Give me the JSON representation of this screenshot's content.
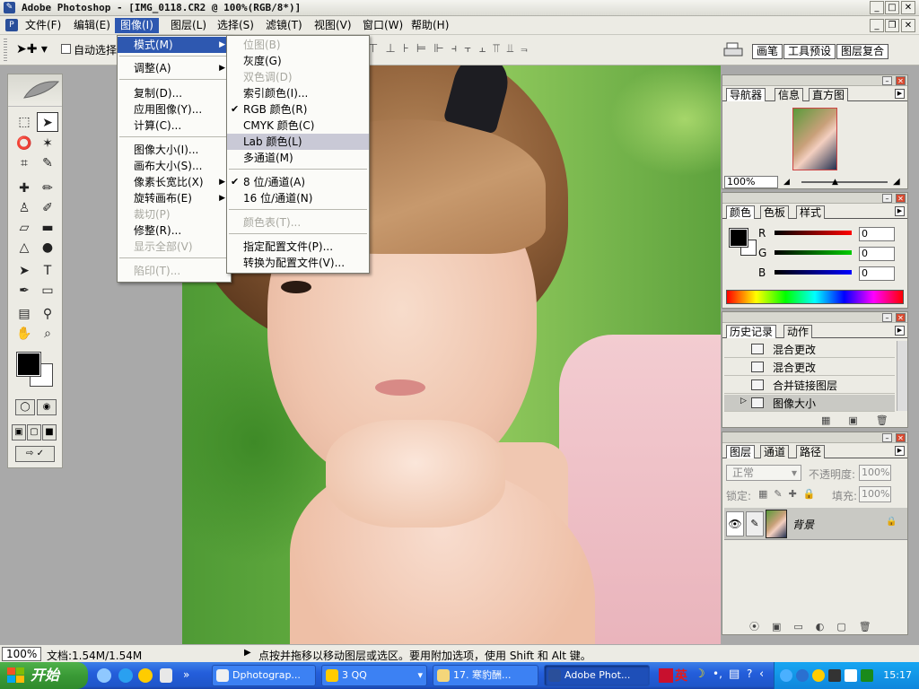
{
  "window": {
    "title": "Adobe Photoshop - [IMG_0118.CR2 @ 100%(RGB/8*)]",
    "app_icon": "photoshop-icon"
  },
  "menubar": {
    "items": [
      "文件(F)",
      "编辑(E)",
      "图像(I)",
      "图层(L)",
      "选择(S)",
      "滤镜(T)",
      "视图(V)",
      "窗口(W)",
      "帮助(H)"
    ],
    "active": "图像(I)"
  },
  "options": {
    "autoselect_label": "自动选择"
  },
  "well_tabs": [
    "画笔",
    "工具预设",
    "图层复合"
  ],
  "image_menu": {
    "items": [
      {
        "label": "模式(M)",
        "submenu": true,
        "state": "highlight"
      },
      {
        "label": "调整(A)",
        "submenu": true
      },
      {
        "label": "复制(D)..."
      },
      {
        "label": "应用图像(Y)..."
      },
      {
        "label": "计算(C)..."
      },
      {
        "label": "图像大小(I)..."
      },
      {
        "label": "画布大小(S)..."
      },
      {
        "label": "像素长宽比(X)",
        "submenu": true
      },
      {
        "label": "旋转画布(E)",
        "submenu": true
      },
      {
        "label": "裁切(P)",
        "disabled": true
      },
      {
        "label": "修整(R)..."
      },
      {
        "label": "显示全部(V)",
        "disabled": true
      },
      {
        "label": "陷印(T)...",
        "disabled": true
      }
    ]
  },
  "mode_submenu": {
    "items": [
      {
        "label": "位图(B)",
        "disabled": true
      },
      {
        "label": "灰度(G)"
      },
      {
        "label": "双色调(D)",
        "disabled": true
      },
      {
        "label": "索引颜色(I)..."
      },
      {
        "label": "RGB 颜色(R)",
        "checked": true
      },
      {
        "label": "CMYK 颜色(C)"
      },
      {
        "label": "Lab 颜色(L)",
        "hover": true
      },
      {
        "label": "多通道(M)"
      },
      {
        "label": "8 位/通道(A)",
        "checked": true
      },
      {
        "label": "16 位/通道(N)"
      },
      {
        "label": "颜色表(T)...",
        "disabled": true
      },
      {
        "label": "指定配置文件(P)..."
      },
      {
        "label": "转换为配置文件(V)..."
      }
    ]
  },
  "navigator": {
    "tabs": [
      "导航器",
      "信息",
      "直方图"
    ],
    "zoom": "100%"
  },
  "color_panel": {
    "tabs": [
      "颜色",
      "色板",
      "样式"
    ],
    "channels": [
      {
        "name": "R",
        "value": "0",
        "color": "#e00000"
      },
      {
        "name": "G",
        "value": "0",
        "color": "#00b000"
      },
      {
        "name": "B",
        "value": "0",
        "color": "#0000e0"
      }
    ]
  },
  "history_panel": {
    "tabs": [
      "历史记录",
      "动作"
    ],
    "items": [
      "混合更改",
      "混合更改",
      "合并链接图层",
      "图像大小"
    ],
    "selected": 3
  },
  "layers_panel": {
    "tabs": [
      "图层",
      "通道",
      "路径"
    ],
    "blend_mode": "正常",
    "opacity_label": "不透明度:",
    "opacity_value": "100%",
    "lock_label": "锁定:",
    "fill_label": "填充:",
    "fill_value": "100%",
    "layers": [
      {
        "name": "背景"
      }
    ]
  },
  "statusbar": {
    "zoom": "100%",
    "doc_info": "文档:1.54M/1.54M",
    "hint": "点按并拖移以移动图层或选区。要用附加选项，使用 Shift 和 Alt 键。"
  },
  "taskbar": {
    "start_label": "开始",
    "tasks": [
      {
        "label": "Dphotograp...",
        "icon": "browser-icon"
      },
      {
        "label": "3 QQ",
        "icon": "qq-icon"
      },
      {
        "label": "17. 寒豹酬...",
        "icon": "folder-icon"
      },
      {
        "label": "Adobe Phot...",
        "icon": "photoshop-icon",
        "active": true
      }
    ],
    "ime": "英",
    "clock": "15:17"
  }
}
